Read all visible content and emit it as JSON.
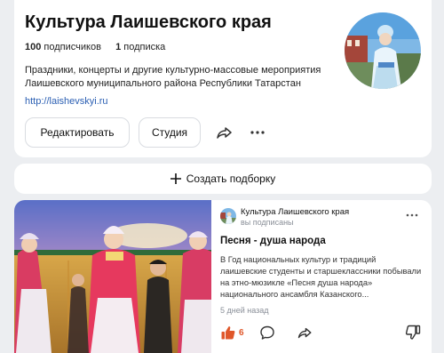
{
  "channel": {
    "title": "Культура Лаишевского края",
    "subscribers_count": "100",
    "subscribers_label": "подписчиков",
    "subscriptions_count": "1",
    "subscriptions_label": "подписка",
    "description": "Праздники, концерты и другие культурно-массовые мероприятия Лаишевского муниципального района Республики Татарстан",
    "link": "http://laishevskyi.ru",
    "edit_label": "Редактировать",
    "studio_label": "Студия",
    "avatar_icon": "channel-avatar"
  },
  "collection": {
    "create_label": "Создать подборку"
  },
  "post": {
    "author": "Культура Лаишевского края",
    "author_status": "вы подписаны",
    "title": "Песня - душа народа",
    "text": "В Год национальных культур и традиций лаишевские студенты и старшеклассники побывали на этно-мюзикле «Песня душа народа» национального ансамбля Казанского...",
    "time": "5 дней назад",
    "likes": "6"
  },
  "colors": {
    "background": "#eceef1",
    "accent_like": "#e0572a",
    "link": "#2b5fb3"
  }
}
